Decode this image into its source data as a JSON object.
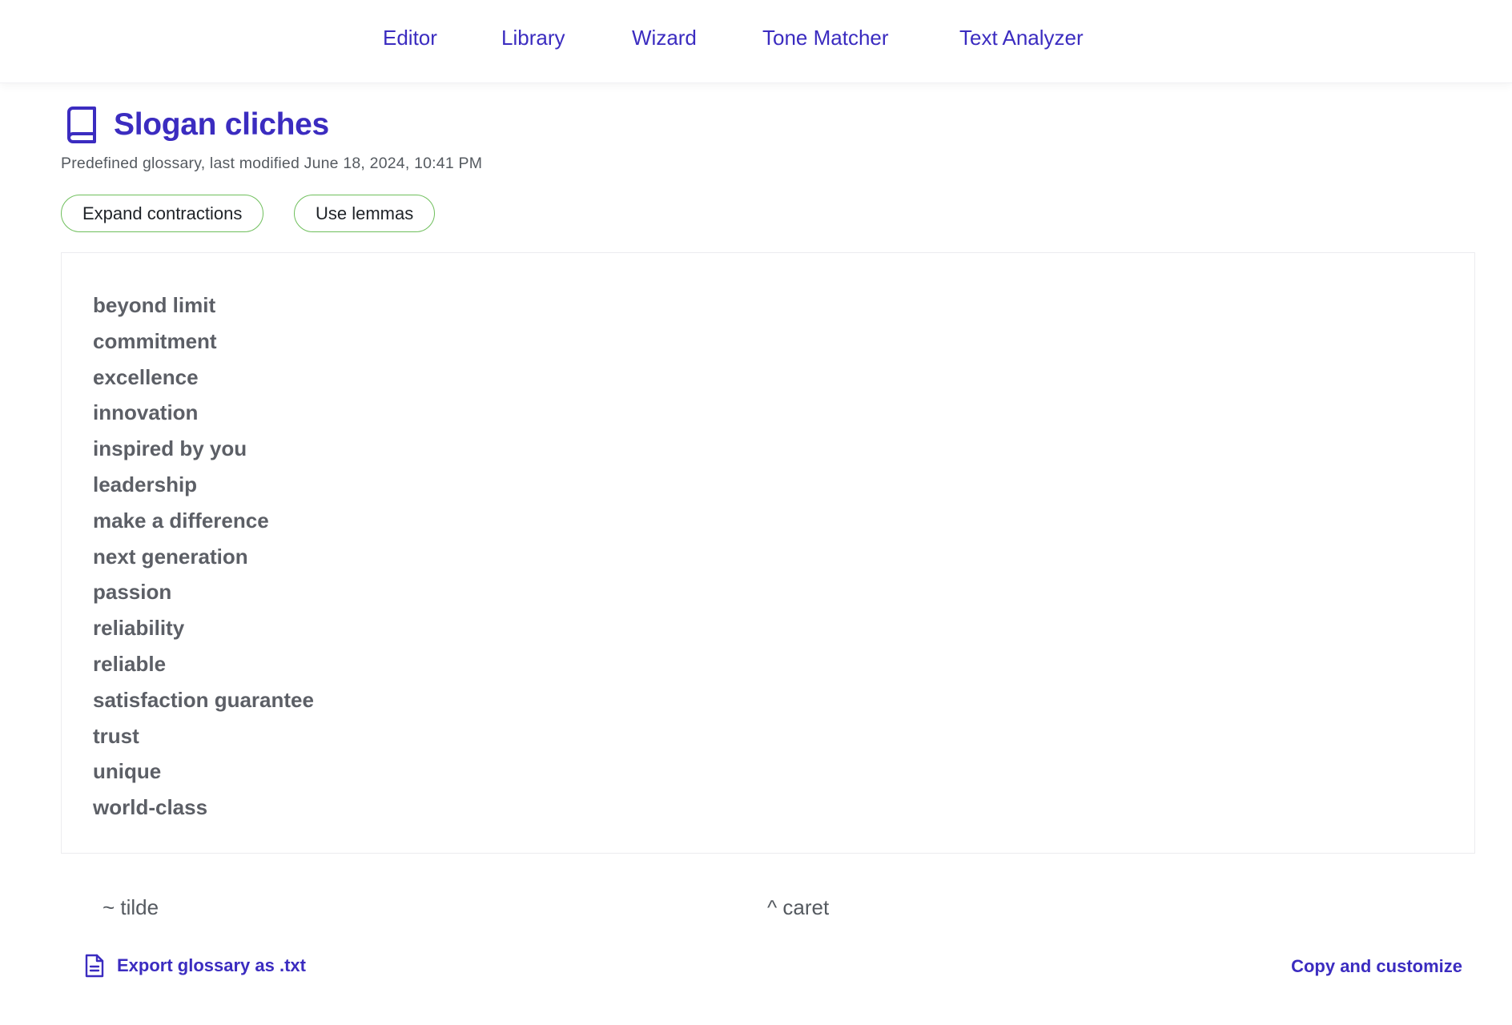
{
  "nav": {
    "items": [
      {
        "label": "Editor"
      },
      {
        "label": "Library"
      },
      {
        "label": "Wizard"
      },
      {
        "label": "Tone Matcher"
      },
      {
        "label": "Text Analyzer"
      }
    ]
  },
  "glossary": {
    "icon": "book-icon",
    "title": "Slogan cliches",
    "subtitle": "Predefined glossary, last modified June 18, 2024, 10:41 PM",
    "options": [
      {
        "label": "Expand contractions"
      },
      {
        "label": "Use lemmas"
      }
    ],
    "terms": [
      "beyond limit",
      "commitment",
      "excellence",
      "innovation",
      "inspired by you",
      "leadership",
      "make a difference",
      "next generation",
      "passion",
      "reliability",
      "reliable",
      "satisfaction guarantee",
      "trust",
      "unique",
      "world-class"
    ]
  },
  "legend": {
    "tilde": "~ tilde",
    "caret": "^ caret"
  },
  "actions": {
    "export_icon": "document-icon",
    "export_label": "Export glossary as .txt",
    "copy_label": "Copy and customize"
  },
  "colors": {
    "accent": "#3b2cc0",
    "chip_border": "#6fbf5c",
    "term_text": "#5c5f66"
  }
}
